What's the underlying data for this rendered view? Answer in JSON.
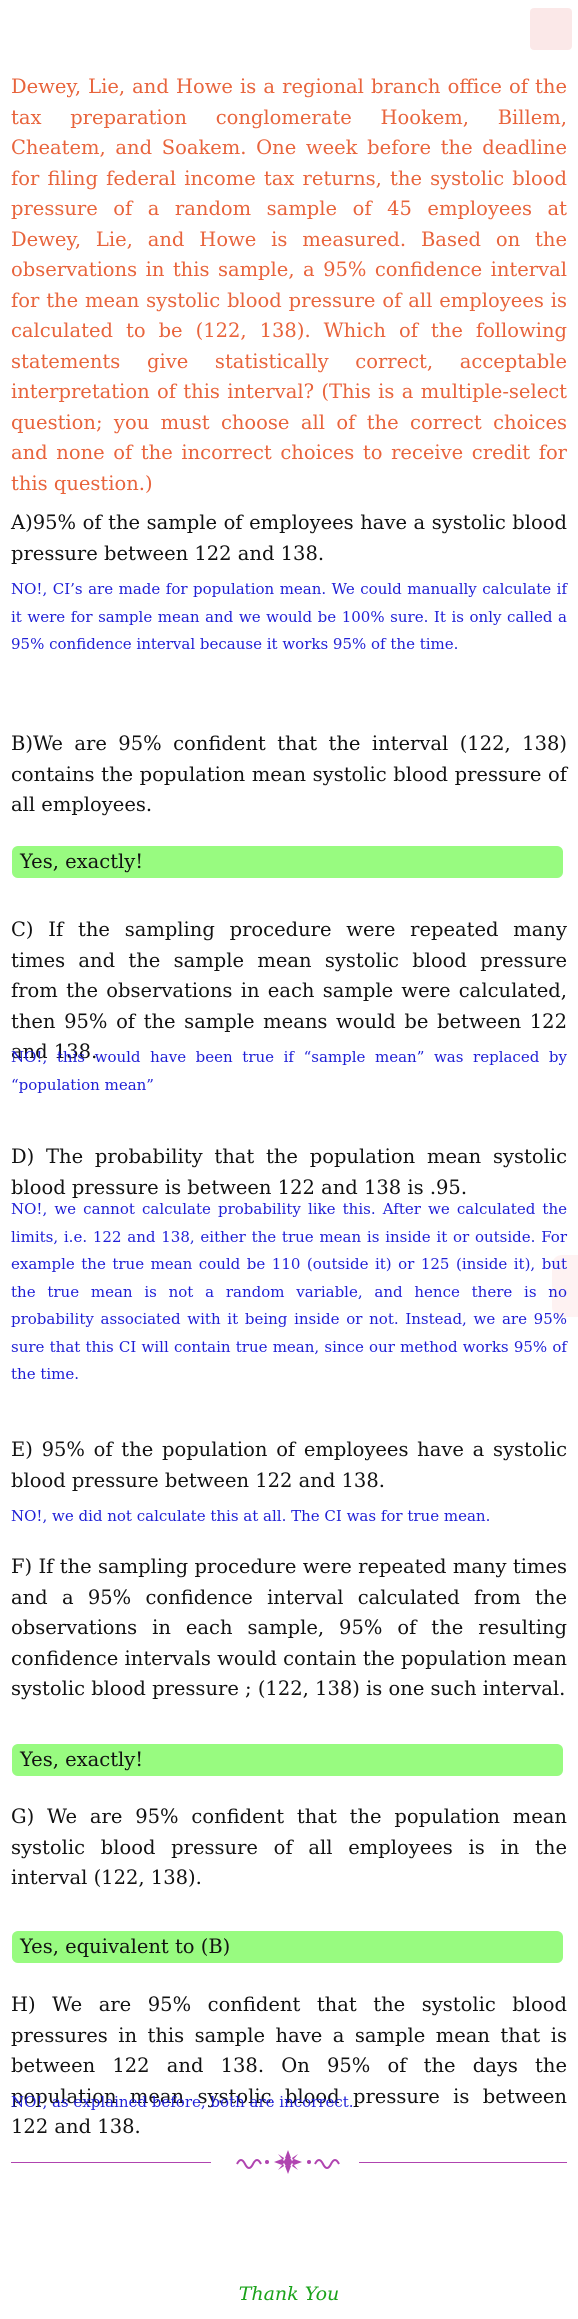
{
  "question": "Dewey, Lie, and Howe is a regional branch office of the tax preparation conglomerate Hookem, Billem, Cheatem, and Soakem. One week before the deadline for filing federal income tax returns, the systolic blood pressure of a random sample of 45 employees at Dewey, Lie, and Howe is measured. Based on the observations in this sample, a 95% confidence interval for the mean systolic blood pressure of all employees is calculated to be (122, 138). Which of the following statements give statistically correct, acceptable interpretation of this interval? (This is a multiple-select question; you must choose all of the correct choices and none of the incorrect choices to receive credit for this question.)",
  "options": {
    "a": {
      "text": "A)95% of the sample of employees have a systolic blood pressure between 122 and 138.",
      "note": "NO!, CI’s are made for population mean. We could manually calculate if it were for sample mean and we would be 100% sure. It is only called a 95% confidence interval because it works 95% of the time."
    },
    "b": {
      "text": "B)We are 95% confident that the interval (122, 138) contains the population mean systolic blood pressure of all employees.",
      "answer": "Yes, exactly!"
    },
    "c": {
      "text": "C) If the sampling procedure were repeated many times and the sample mean systolic blood pressure from the observations in each sample were calculated, then 95% of the sample means would be between 122 and 138.",
      "note": "NO!, this would have been true if “sample mean” was replaced by “population mean”"
    },
    "d": {
      "text": "D) The probability that the population mean systolic blood pressure is between 122 and 138 is .95.",
      "note": "NO!, we cannot calculate probability like this. After we calculated the limits, i.e. 122 and 138, either the true mean is inside it or outside. For example the true mean could be 110 (outside it) or 125 (inside it), but the true mean is not a random variable, and hence there is no probability associated with it being inside or not. Instead, we are 95% sure that this CI will contain true mean, since our method works 95% of the time."
    },
    "e": {
      "text": "E) 95% of the population of employees have a systolic blood pressure between 122 and 138.",
      "note": "NO!, we did not calculate this at all. The CI was for true mean."
    },
    "f": {
      "text": "F) If the sampling procedure were repeated many times and a 95% confidence interval calculated from the observations in each sample, 95% of the resulting confidence intervals would contain the population mean systolic blood pressure ; (122, 138) is one such interval.",
      "answer": "Yes, exactly!"
    },
    "g": {
      "text": "G) We are 95% confident that the population mean systolic blood pressure of all employees is in the interval (122, 138).",
      "answer": "Yes, equivalent to (B)"
    },
    "h": {
      "text": "H) We are 95% confident that the systolic blood pressures in this sample have a sample mean that is between 122 and 138. On 95% of the days the population mean systolic blood pressure is between 122 and 138.",
      "note": "NO!, as explained before, both are incorrect."
    }
  },
  "closing": "Thank You",
  "colors": {
    "question": "#e8643c",
    "note": "#1f1fd6",
    "answer_bg": "#98fb80",
    "ornament": "#b044b0",
    "closing": "#1aa31a"
  }
}
